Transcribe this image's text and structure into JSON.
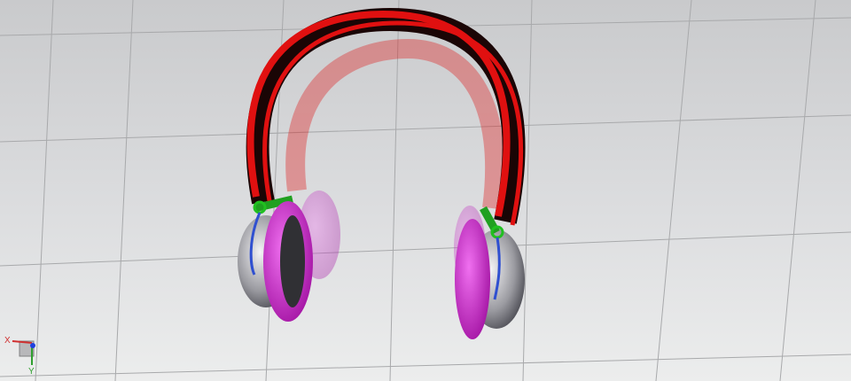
{
  "viewport": {
    "model": "headphones",
    "colors": {
      "band": "#e01010",
      "cushion": "#e020e0",
      "connector": "#20b020",
      "wire": "#3050d0",
      "shell": "#c0c0c8"
    }
  },
  "triad": {
    "x_label": "X",
    "y_label": "Y"
  }
}
